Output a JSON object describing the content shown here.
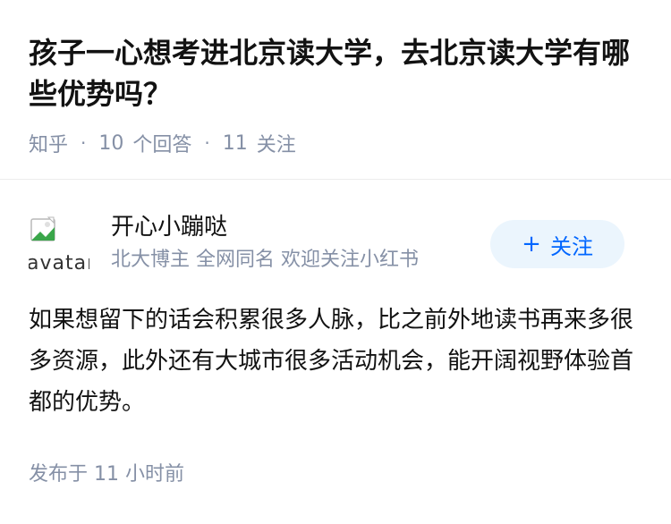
{
  "question": {
    "title": "孩子一心想考进北京读大学，去北京读大学有哪些优势吗？",
    "source": "知乎",
    "separator": "·",
    "answer_count": "10",
    "answer_label": "个回答",
    "follower_count": "11",
    "follower_label": "关注"
  },
  "answer": {
    "author": {
      "avatar_alt": "avatar",
      "name": "开心小蹦哒",
      "bio": "北大博主 全网同名 欢迎关注小红书"
    },
    "follow_button": {
      "icon": "plus-icon",
      "symbol": "+",
      "label": "关注"
    },
    "content": "如果想留下的话会积累很多人脉，比之前外地读书再来多很多资源，此外还有大城市很多活动机会，能开阔视野体验首都的优势。",
    "publish_time": "发布于  11 小时前"
  },
  "colors": {
    "title_text": "#121212",
    "meta_text": "#8590a6",
    "accent_blue": "#0066ff",
    "follow_button_bg": "#ebf5fd",
    "divider": "#ececec"
  }
}
